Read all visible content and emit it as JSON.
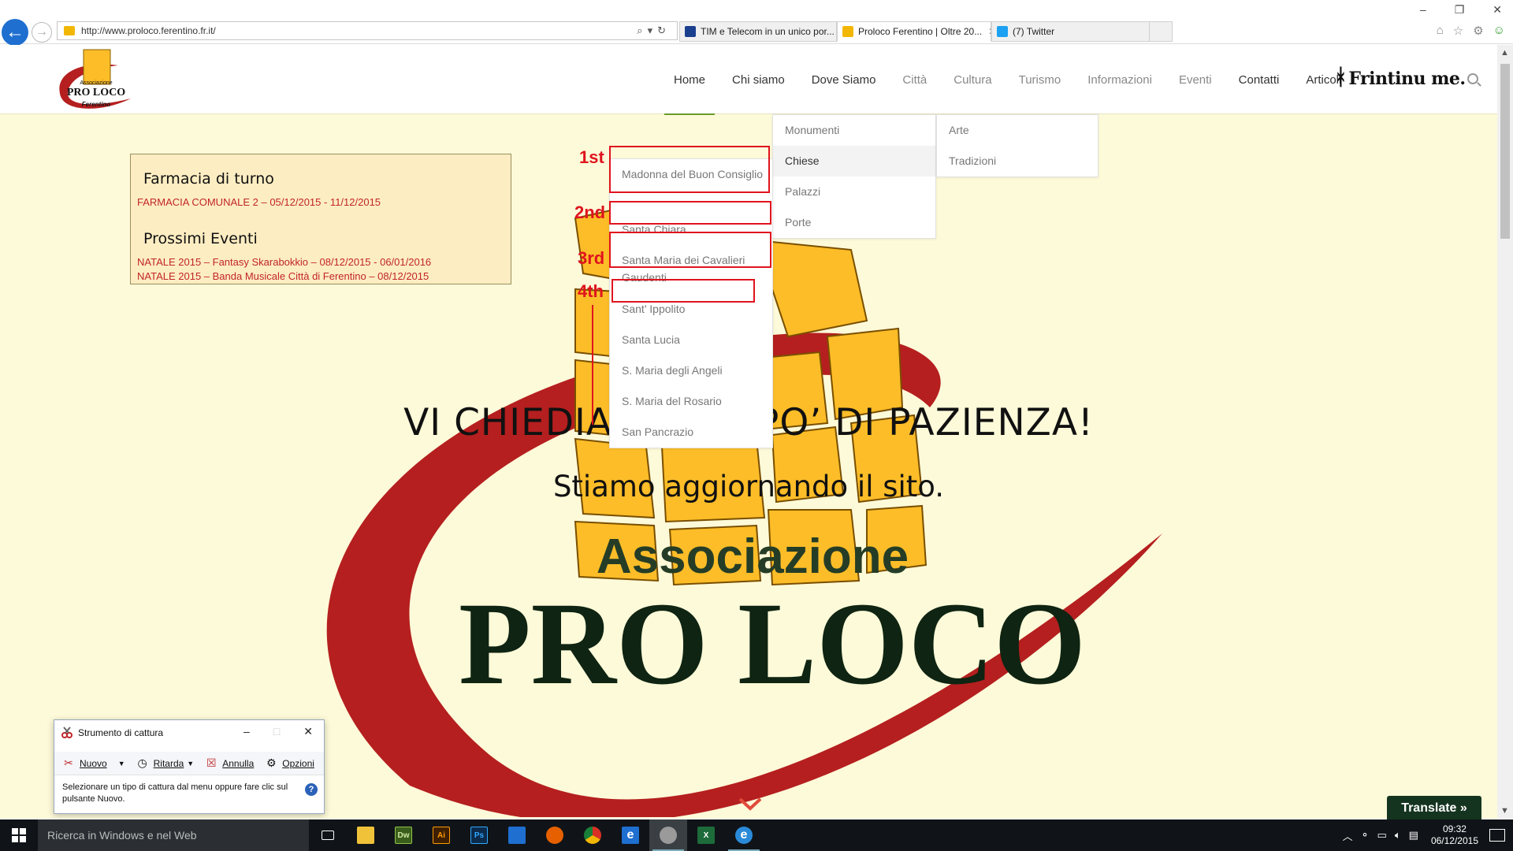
{
  "browser": {
    "url": "http://www.proloco.ferentino.fr.it/",
    "tabs": [
      {
        "title": "TIM e Telecom in un unico por...",
        "icon": "tim-icon",
        "color": "#1b3f8f"
      },
      {
        "title": "Proloco Ferentino | Oltre 20...",
        "icon": "proloco-favicon",
        "color": "#f2b705",
        "active": true
      },
      {
        "title": "(7) Twitter",
        "icon": "twitter-icon",
        "color": "#1da1f2"
      }
    ],
    "window_controls": [
      "–",
      "❐",
      "✕"
    ],
    "toolbar_icons": [
      "home-icon",
      "favorites-star-icon",
      "settings-gear-icon",
      "feedback-smiley-icon"
    ]
  },
  "site": {
    "logo_text_top": "Associazione",
    "logo_text_mid": "PRO LOCO",
    "logo_text_bottom": "Ferentino",
    "nav": [
      "Home",
      "Chi siamo",
      "Dove Siamo",
      "Città",
      "Cultura",
      "Turismo",
      "Informazioni",
      "Eventi",
      "Contatti",
      "Articoli"
    ],
    "brand_script": "Frintinu me.",
    "citta_menu": [
      "Monumenti",
      "Chiese",
      "Palazzi",
      "Porte"
    ],
    "cultura_menu": [
      "Arte",
      "Tradizioni"
    ],
    "chiese_menu": [
      "Madonna del Buon Consiglio",
      "Santa Chiara",
      "Santa Maria dei Cavalieri Gaudenti",
      "Sant’ Ippolito",
      "Santa Lucia",
      "S. Maria degli Angeli",
      "S. Maria del Rosario",
      "San Pancrazio"
    ],
    "annotations": [
      "1st",
      "2nd",
      "3rd",
      "4th"
    ],
    "notice": {
      "farmacia_title": "Farmacia di turno",
      "farmacia_line": "FARMACIA COMUNALE 2 – 05/12/2015 - 11/12/2015",
      "eventi_title": "Prossimi Eventi",
      "eventi_lines": [
        "NATALE 2015 – Fantasy Skarabokkio – 08/12/2015 - 06/01/2016",
        "NATALE 2015 – Banda Musicale Città di Ferentino – 08/12/2015"
      ]
    },
    "headline": "VI CHIEDIAMO UN PO’ DI PAZIENZA!",
    "subline": "Stiamo aggiornando il sito.",
    "art_line1": "Associazione",
    "art_line2": "PRO LOCO",
    "translate_label": "Translate »",
    "colors": {
      "accent_red": "#e0141e",
      "stone_yellow": "#fcbd28",
      "swoosh_red": "#b51f1f",
      "logo_green": "#1c2f20"
    }
  },
  "snipping_tool": {
    "title": "Strumento di cattura",
    "buttons": [
      "Nuovo",
      "Ritarda",
      "Annulla",
      "Opzioni"
    ],
    "message": "Selezionare un tipo di cattura dal menu oppure fare clic sul pulsante Nuovo."
  },
  "taskbar": {
    "search_placeholder": "Ricerca in Windows e nel Web",
    "apps": [
      {
        "name": "task-view-icon",
        "label": "",
        "color": "#101418"
      },
      {
        "name": "file-explorer-icon",
        "label": "",
        "color": "#f0c23a"
      },
      {
        "name": "dreamweaver-icon",
        "label": "Dw",
        "color": "#3a5d1b"
      },
      {
        "name": "illustrator-icon",
        "label": "Ai",
        "color": "#3d1f00"
      },
      {
        "name": "photoshop-icon",
        "label": "Ps",
        "color": "#0c2a4a"
      },
      {
        "name": "store-icon",
        "label": "",
        "color": "#1e6fd0"
      },
      {
        "name": "firefox-icon",
        "label": "",
        "color": "#e66000"
      },
      {
        "name": "chrome-icon",
        "label": "",
        "color": "#d93025"
      },
      {
        "name": "edge-icon",
        "label": "e",
        "color": "#1e6fd0"
      },
      {
        "name": "snipping-tool-icon",
        "label": "",
        "color": "#9a9a9a"
      },
      {
        "name": "excel-icon",
        "label": "X",
        "color": "#1d6b3a"
      },
      {
        "name": "internet-explorer-icon",
        "label": "e",
        "color": "#2a8ad8"
      }
    ],
    "time": "09:32",
    "date": "06/12/2015"
  }
}
